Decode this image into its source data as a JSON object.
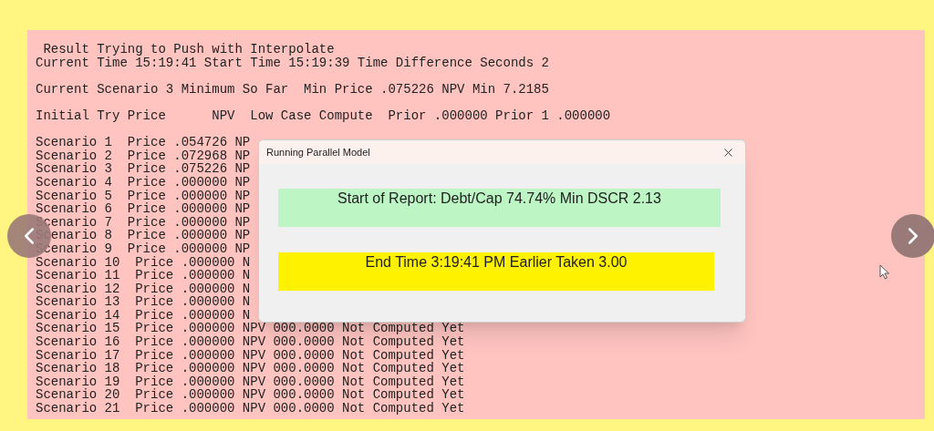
{
  "report": {
    "header_groups": [
      [
        " Result Trying to Push with Interpolate",
        "Current Time 15:19:41 Start Time 15:19:39 Time Difference Seconds 2"
      ],
      [
        "Current Scenario 3 Minimum So Far  Min Price .075226 NPV Min 7.2185"
      ],
      [
        "Initial Try Price      NPV  Low Case Compute  Prior .000000 Prior 1 .000000"
      ]
    ],
    "scenario_rows": [
      "Scenario 1  Price .054726 NP",
      "Scenario 2  Price .072968 NP",
      "Scenario 3  Price .075226 NP",
      "Scenario 4  Price .000000 NP",
      "Scenario 5  Price .000000 NP",
      "Scenario 6  Price .000000 NP",
      "Scenario 7  Price .000000 NP",
      "Scenario 8  Price .000000 NP",
      "Scenario 9  Price .000000 NP",
      "Scenario 10  Price .000000 N",
      "Scenario 11  Price .000000 N",
      "Scenario 12  Price .000000 N",
      "Scenario 13  Price .000000 N",
      "Scenario 14  Price .000000 N",
      "Scenario 15  Price .000000 NPV 000.0000 Not Computed Yet",
      "Scenario 16  Price .000000 NPV 000.0000 Not Computed Yet",
      "Scenario 17  Price .000000 NPV 000.0000 Not Computed Yet",
      "Scenario 18  Price .000000 NPV 000.0000 Not Computed Yet",
      "Scenario 19  Price .000000 NPV 000.0000 Not Computed Yet",
      "Scenario 20  Price .000000 NPV 000.0000 Not Computed Yet",
      "Scenario 21  Price .000000 NPV 000.0000 Not Computed Yet"
    ]
  },
  "dialog": {
    "title": "Running Parallel Model",
    "messages": [
      {
        "text": "Start of Report: Debt/Cap  74.74% Min DSCR 2.13",
        "color": "#bdf5c5"
      },
      {
        "text": "End Time 3:19:41 PM Earlier Taken 3.00",
        "color": "#fff200"
      }
    ]
  }
}
